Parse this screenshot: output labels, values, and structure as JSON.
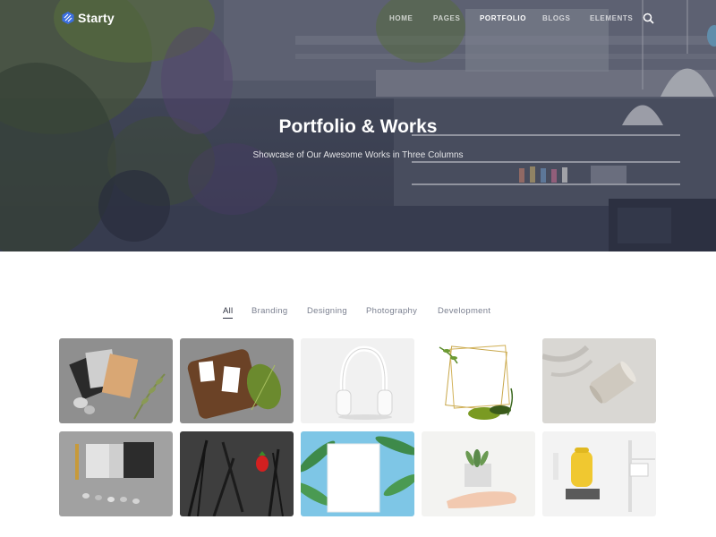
{
  "brand": {
    "name": "Starty",
    "accent": "#3b6fe0"
  },
  "nav": {
    "items": [
      {
        "label": "HOME",
        "active": false
      },
      {
        "label": "PAGES",
        "active": false
      },
      {
        "label": "PORTFOLIO",
        "active": true
      },
      {
        "label": "BLOGS",
        "active": false
      },
      {
        "label": "ELEMENTS",
        "active": false
      }
    ],
    "search_icon": "search-icon"
  },
  "hero": {
    "title": "Portfolio & Works",
    "subtitle": "Showcase of Our Awesome Works in Three Columns"
  },
  "filters": {
    "items": [
      {
        "label": "All",
        "active": true
      },
      {
        "label": "Branding",
        "active": false
      },
      {
        "label": "Designing",
        "active": false
      },
      {
        "label": "Photography",
        "active": false
      },
      {
        "label": "Development",
        "active": false
      }
    ]
  },
  "portfolio": {
    "items": [
      {
        "subject": "stationery-cards-pebbles"
      },
      {
        "subject": "wooden-board-cards-leaf"
      },
      {
        "subject": "white-headphones"
      },
      {
        "subject": "gold-frame-plants"
      },
      {
        "subject": "paper-cup-shadow"
      },
      {
        "subject": "envelopes-pen-stones"
      },
      {
        "subject": "dark-cutlery-strawberry"
      },
      {
        "subject": "frame-palm-leaves"
      },
      {
        "subject": "hand-succulent"
      },
      {
        "subject": "yellow-backpack-room"
      }
    ]
  }
}
